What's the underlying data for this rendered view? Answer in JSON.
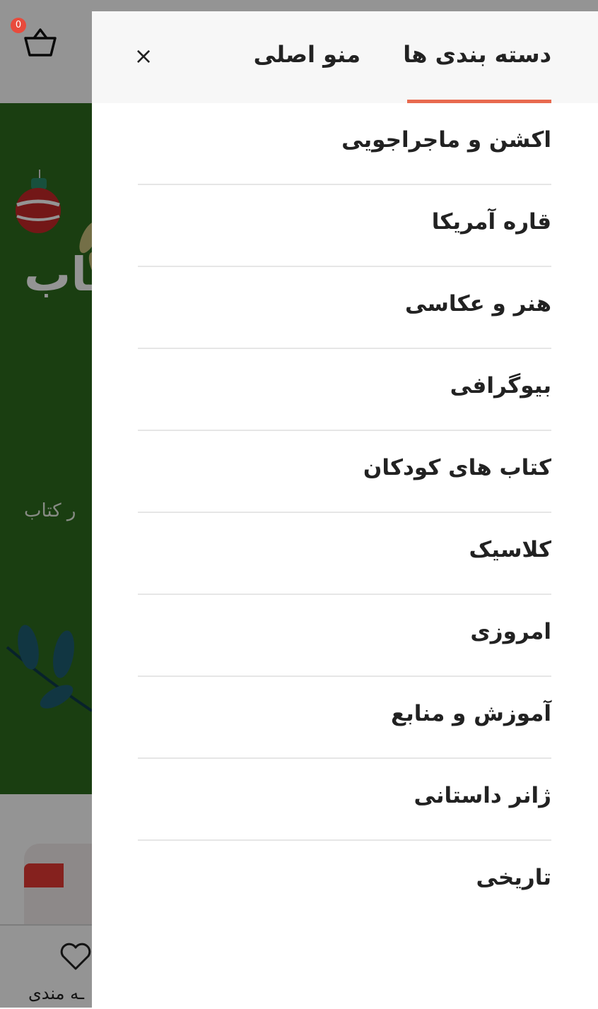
{
  "background": {
    "cart_count": "0",
    "banner_title": "ـاب",
    "banner_subtitle": "ر کتاب",
    "bottom_nav": {
      "wishlist_label": "ـه مندی"
    },
    "colors": {
      "banner": "#2d6b1e",
      "badge": "#e84b3c"
    }
  },
  "drawer": {
    "tabs": [
      {
        "label": "دسته بندی ها",
        "active": true
      },
      {
        "label": "منو اصلی",
        "active": false
      }
    ],
    "close_label": "×",
    "accent_color": "#e86a4f",
    "categories": [
      {
        "label": "اکشن و ماجراجویی"
      },
      {
        "label": "قاره آمریکا"
      },
      {
        "label": "هنر و عکاسی"
      },
      {
        "label": "بیوگرافی"
      },
      {
        "label": "کتاب های کودکان"
      },
      {
        "label": "کلاسیک"
      },
      {
        "label": "امروزی"
      },
      {
        "label": "آموزش و منابع"
      },
      {
        "label": "ژانر داستانی"
      },
      {
        "label": "تاریخی"
      }
    ]
  }
}
